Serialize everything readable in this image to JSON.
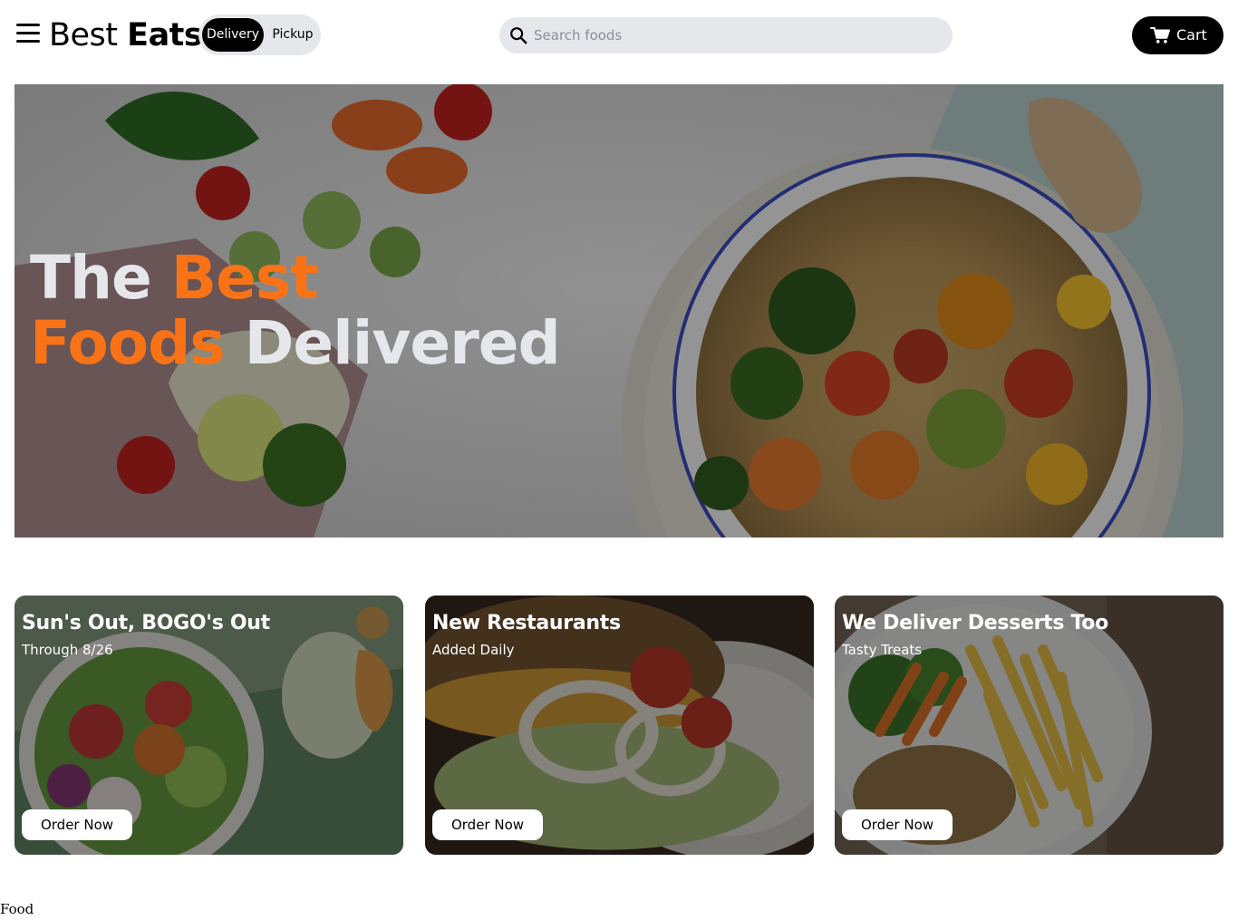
{
  "header": {
    "brand_light": "Best",
    "brand_bold": "Eats",
    "mode_options": [
      "Delivery",
      "Pickup"
    ],
    "active_mode": "Delivery",
    "search_placeholder": "Search foods",
    "cart_label": "Cart"
  },
  "hero": {
    "line1_plain": "The",
    "line1_accent": "Best",
    "line2_accent": "Foods",
    "line2_plain": "Delivered",
    "accent_color": "#f97316"
  },
  "cards": [
    {
      "title": "Sun's Out, BOGO's Out",
      "subtitle": "Through 8/26",
      "button": "Order Now"
    },
    {
      "title": "New Restaurants",
      "subtitle": "Added Daily",
      "button": "Order Now"
    },
    {
      "title": "We Deliver Desserts Too",
      "subtitle": "Tasty Treats",
      "button": "Order Now"
    }
  ],
  "footer_label": "Food",
  "icons": {
    "menu": "hamburger-menu-icon",
    "search": "search-icon",
    "cart": "shopping-cart-icon"
  }
}
